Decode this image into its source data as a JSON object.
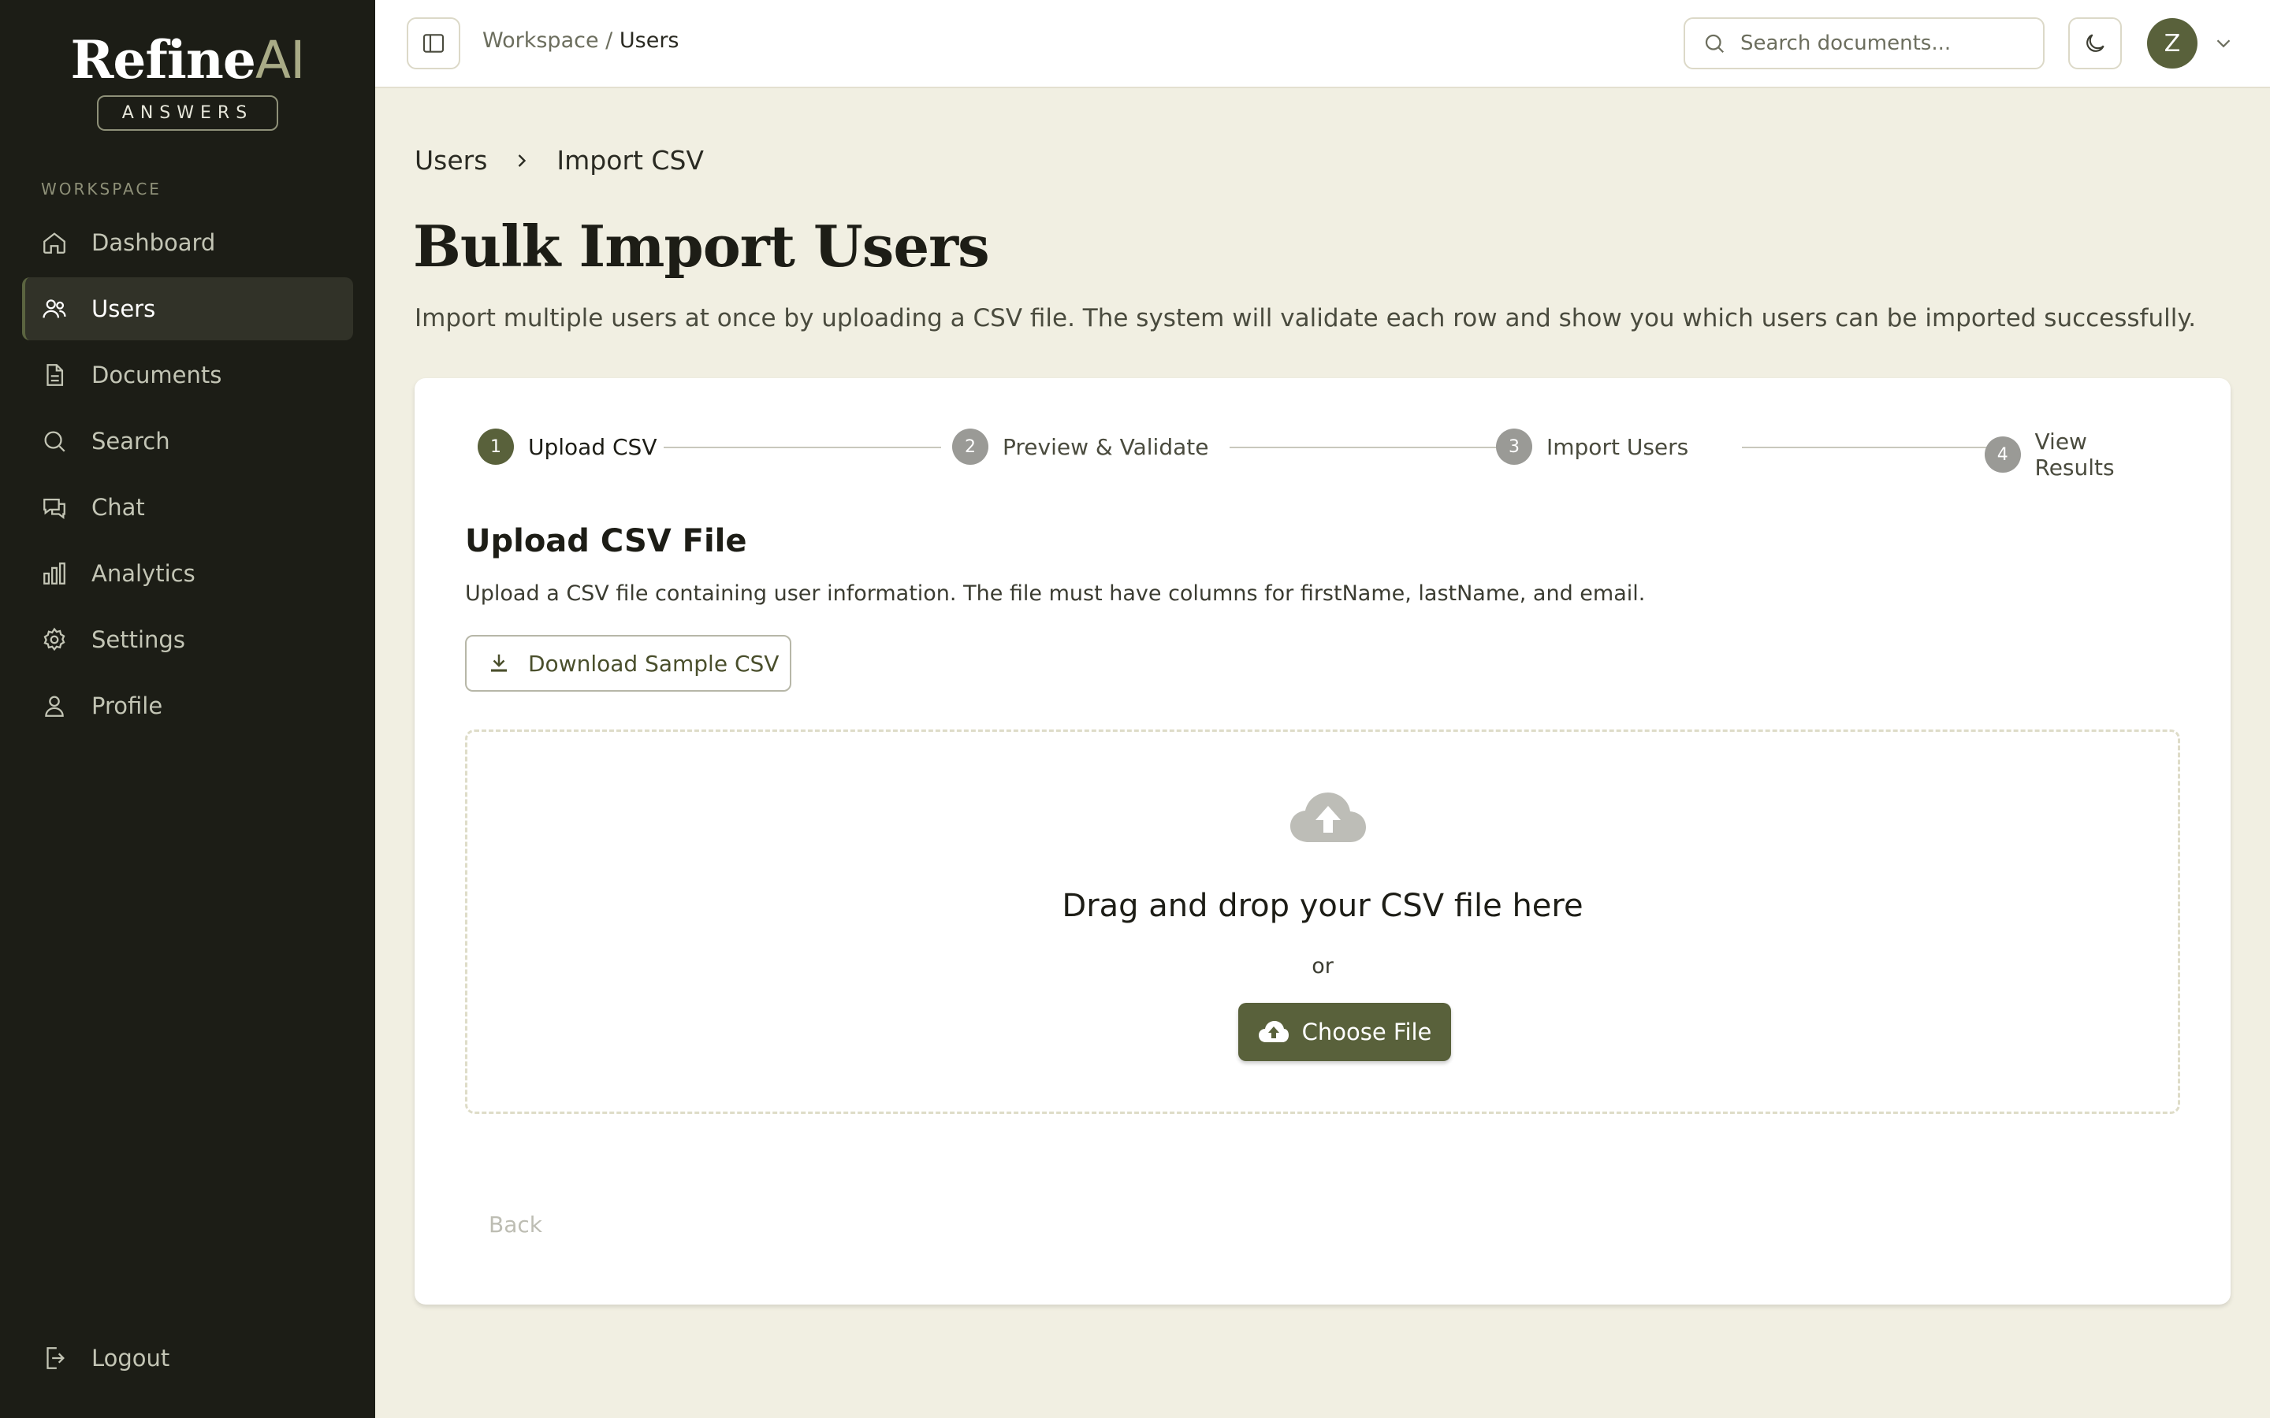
{
  "sidebar": {
    "logo_main": "Refine",
    "logo_accent": "AI",
    "logo_tag": "ANSWERS",
    "section_label": "WORKSPACE",
    "items": [
      {
        "label": "Dashboard",
        "icon": "home-icon"
      },
      {
        "label": "Users",
        "icon": "users-icon",
        "active": true
      },
      {
        "label": "Documents",
        "icon": "document-icon"
      },
      {
        "label": "Search",
        "icon": "search-icon"
      },
      {
        "label": "Chat",
        "icon": "chat-icon"
      },
      {
        "label": "Analytics",
        "icon": "bar-chart-icon"
      },
      {
        "label": "Settings",
        "icon": "gear-icon"
      },
      {
        "label": "Profile",
        "icon": "user-icon"
      }
    ],
    "logout_label": "Logout"
  },
  "header": {
    "breadcrumb_root": "Workspace",
    "breadcrumb_sep": "/",
    "breadcrumb_current": "Users",
    "search_placeholder": "Search documents...",
    "avatar_initial": "Z"
  },
  "main": {
    "crumb_parent": "Users",
    "crumb_current": "Import CSV",
    "title": "Bulk Import Users",
    "description": "Import multiple users at once by uploading a CSV file. The system will validate each row and show you which users can be imported successfully.",
    "steps": [
      {
        "num": "1",
        "label": "Upload CSV",
        "active": true
      },
      {
        "num": "2",
        "label": "Preview & Validate"
      },
      {
        "num": "3",
        "label": "Import Users"
      },
      {
        "num": "4",
        "label": "View Results"
      }
    ],
    "section_title": "Upload CSV File",
    "section_desc": "Upload a CSV file containing user information. The file must have columns for firstName, lastName, and email.",
    "download_label": "Download Sample CSV",
    "drop_title": "Drag and drop your CSV file here",
    "drop_or": "or",
    "choose_label": "Choose File",
    "back_label": "Back"
  },
  "colors": {
    "accent": "#59613b",
    "sidebar_bg": "#1c1d16",
    "page_bg": "#f1efe2"
  }
}
